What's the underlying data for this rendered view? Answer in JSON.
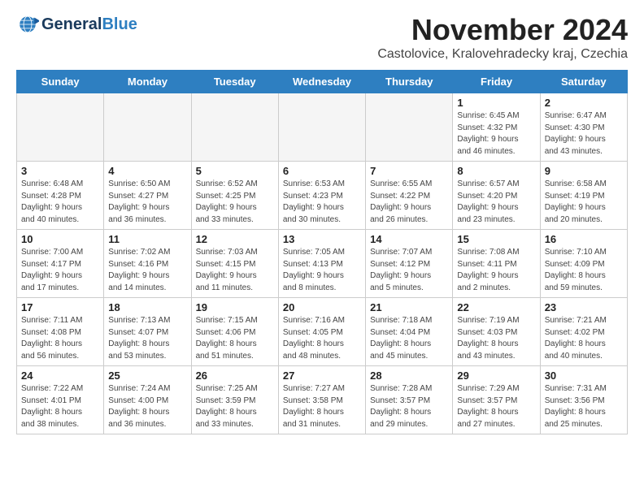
{
  "header": {
    "logo_line1": "General",
    "logo_line2": "Blue",
    "month": "November 2024",
    "location": "Castolovice, Kralovehradecky kraj, Czechia"
  },
  "days_of_week": [
    "Sunday",
    "Monday",
    "Tuesday",
    "Wednesday",
    "Thursday",
    "Friday",
    "Saturday"
  ],
  "weeks": [
    [
      {
        "day": "",
        "info": ""
      },
      {
        "day": "",
        "info": ""
      },
      {
        "day": "",
        "info": ""
      },
      {
        "day": "",
        "info": ""
      },
      {
        "day": "",
        "info": ""
      },
      {
        "day": "1",
        "info": "Sunrise: 6:45 AM\nSunset: 4:32 PM\nDaylight: 9 hours\nand 46 minutes."
      },
      {
        "day": "2",
        "info": "Sunrise: 6:47 AM\nSunset: 4:30 PM\nDaylight: 9 hours\nand 43 minutes."
      }
    ],
    [
      {
        "day": "3",
        "info": "Sunrise: 6:48 AM\nSunset: 4:28 PM\nDaylight: 9 hours\nand 40 minutes."
      },
      {
        "day": "4",
        "info": "Sunrise: 6:50 AM\nSunset: 4:27 PM\nDaylight: 9 hours\nand 36 minutes."
      },
      {
        "day": "5",
        "info": "Sunrise: 6:52 AM\nSunset: 4:25 PM\nDaylight: 9 hours\nand 33 minutes."
      },
      {
        "day": "6",
        "info": "Sunrise: 6:53 AM\nSunset: 4:23 PM\nDaylight: 9 hours\nand 30 minutes."
      },
      {
        "day": "7",
        "info": "Sunrise: 6:55 AM\nSunset: 4:22 PM\nDaylight: 9 hours\nand 26 minutes."
      },
      {
        "day": "8",
        "info": "Sunrise: 6:57 AM\nSunset: 4:20 PM\nDaylight: 9 hours\nand 23 minutes."
      },
      {
        "day": "9",
        "info": "Sunrise: 6:58 AM\nSunset: 4:19 PM\nDaylight: 9 hours\nand 20 minutes."
      }
    ],
    [
      {
        "day": "10",
        "info": "Sunrise: 7:00 AM\nSunset: 4:17 PM\nDaylight: 9 hours\nand 17 minutes."
      },
      {
        "day": "11",
        "info": "Sunrise: 7:02 AM\nSunset: 4:16 PM\nDaylight: 9 hours\nand 14 minutes."
      },
      {
        "day": "12",
        "info": "Sunrise: 7:03 AM\nSunset: 4:15 PM\nDaylight: 9 hours\nand 11 minutes."
      },
      {
        "day": "13",
        "info": "Sunrise: 7:05 AM\nSunset: 4:13 PM\nDaylight: 9 hours\nand 8 minutes."
      },
      {
        "day": "14",
        "info": "Sunrise: 7:07 AM\nSunset: 4:12 PM\nDaylight: 9 hours\nand 5 minutes."
      },
      {
        "day": "15",
        "info": "Sunrise: 7:08 AM\nSunset: 4:11 PM\nDaylight: 9 hours\nand 2 minutes."
      },
      {
        "day": "16",
        "info": "Sunrise: 7:10 AM\nSunset: 4:09 PM\nDaylight: 8 hours\nand 59 minutes."
      }
    ],
    [
      {
        "day": "17",
        "info": "Sunrise: 7:11 AM\nSunset: 4:08 PM\nDaylight: 8 hours\nand 56 minutes."
      },
      {
        "day": "18",
        "info": "Sunrise: 7:13 AM\nSunset: 4:07 PM\nDaylight: 8 hours\nand 53 minutes."
      },
      {
        "day": "19",
        "info": "Sunrise: 7:15 AM\nSunset: 4:06 PM\nDaylight: 8 hours\nand 51 minutes."
      },
      {
        "day": "20",
        "info": "Sunrise: 7:16 AM\nSunset: 4:05 PM\nDaylight: 8 hours\nand 48 minutes."
      },
      {
        "day": "21",
        "info": "Sunrise: 7:18 AM\nSunset: 4:04 PM\nDaylight: 8 hours\nand 45 minutes."
      },
      {
        "day": "22",
        "info": "Sunrise: 7:19 AM\nSunset: 4:03 PM\nDaylight: 8 hours\nand 43 minutes."
      },
      {
        "day": "23",
        "info": "Sunrise: 7:21 AM\nSunset: 4:02 PM\nDaylight: 8 hours\nand 40 minutes."
      }
    ],
    [
      {
        "day": "24",
        "info": "Sunrise: 7:22 AM\nSunset: 4:01 PM\nDaylight: 8 hours\nand 38 minutes."
      },
      {
        "day": "25",
        "info": "Sunrise: 7:24 AM\nSunset: 4:00 PM\nDaylight: 8 hours\nand 36 minutes."
      },
      {
        "day": "26",
        "info": "Sunrise: 7:25 AM\nSunset: 3:59 PM\nDaylight: 8 hours\nand 33 minutes."
      },
      {
        "day": "27",
        "info": "Sunrise: 7:27 AM\nSunset: 3:58 PM\nDaylight: 8 hours\nand 31 minutes."
      },
      {
        "day": "28",
        "info": "Sunrise: 7:28 AM\nSunset: 3:57 PM\nDaylight: 8 hours\nand 29 minutes."
      },
      {
        "day": "29",
        "info": "Sunrise: 7:29 AM\nSunset: 3:57 PM\nDaylight: 8 hours\nand 27 minutes."
      },
      {
        "day": "30",
        "info": "Sunrise: 7:31 AM\nSunset: 3:56 PM\nDaylight: 8 hours\nand 25 minutes."
      }
    ]
  ]
}
